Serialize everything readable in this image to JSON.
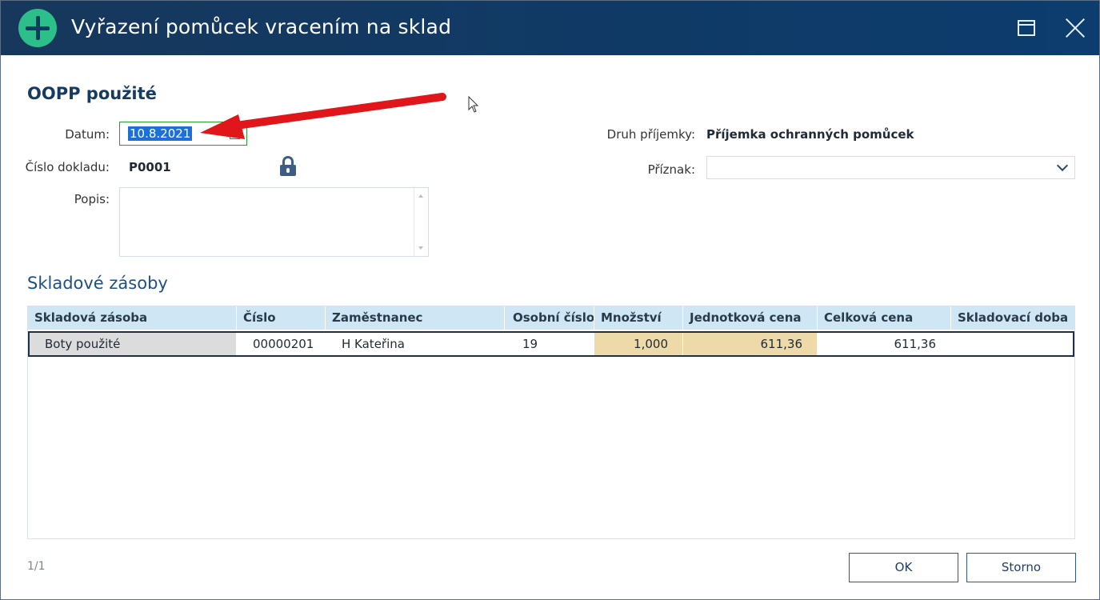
{
  "window": {
    "title": "Vyřazení pomůcek vracením na sklad"
  },
  "form": {
    "section_title": "OOPP použité",
    "datum_label": "Datum:",
    "datum_value": "10.8.2021",
    "cislo_label": "Číslo dokladu:",
    "cislo_value": "P0001",
    "popis_label": "Popis:",
    "popis_value": "",
    "druh_label": "Druh příjemky:",
    "druh_value": "Příjemka ochranných pomůcek",
    "priznak_label": "Příznak:",
    "priznak_value": ""
  },
  "grid": {
    "title": "Skladové zásoby",
    "columns": [
      "Skladová zásoba",
      "Číslo",
      "Zaměstnanec",
      "Osobní číslo",
      "Množství",
      "Jednotková cena",
      "Celková cena",
      "Skladovací doba"
    ],
    "rows": [
      {
        "zasoba": "Boty použité",
        "cislo": "00000201",
        "zamestnanec": "H Kateřina",
        "osobni_cislo": "19",
        "mnozstvi": "1,000",
        "jednotkova_cena": "611,36",
        "celkova_cena": "611,36",
        "skladovaci_doba": ""
      }
    ]
  },
  "footer": {
    "pager": "1/1",
    "ok_label": "OK",
    "storno_label": "Storno"
  },
  "colors": {
    "titlebar": "#0f3a66",
    "accent_green": "#2dbf8a",
    "annotation_arrow": "#e0161b",
    "header_blue": "#cfe6f5",
    "price_highlight": "#eed9a8"
  },
  "icons": [
    "plus-icon",
    "maximize-icon",
    "close-icon",
    "calendar-icon",
    "lock-icon",
    "chevron-down-icon",
    "cursor-icon"
  ]
}
